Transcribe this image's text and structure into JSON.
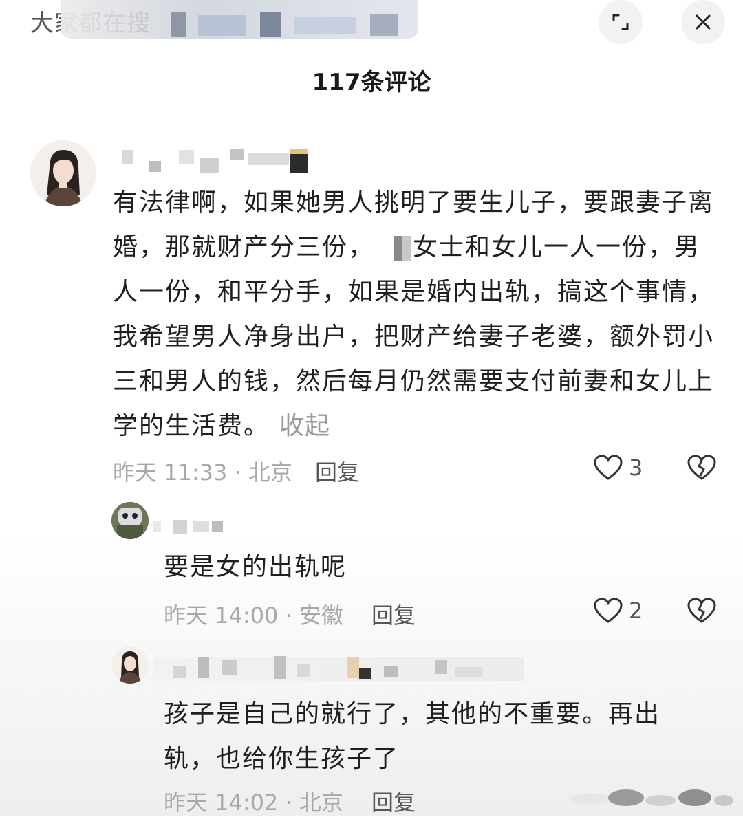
{
  "header": {
    "title_visible": "大家都在搜",
    "comment_count": "117条评论",
    "expand_icon": "expand-icon",
    "close_icon": "close-icon"
  },
  "comments": [
    {
      "avatar": "avatar-woman",
      "text_before_patch": "有法律啊，如果她男人挑明了要生儿子，要跟妻子离婚，那就财产分三份，",
      "text_after_patch": "女士和女儿一人一份，男人一份，和平分手，如果是婚内出轨，搞这个事情，我希望男人净身出户，把财产给妻子老婆，额外罚小三和男人的钱，然后每月仍然需要支付前妻和女儿上学的生活费。",
      "collapse_label": "收起",
      "meta": "昨天 11:33 · 北京",
      "reply_label": "回复",
      "likes": "3"
    },
    {
      "avatar": "avatar-cartoon",
      "text": "要是女的出轨呢",
      "meta": "昨天 14:00 · 安徽",
      "reply_label": "回复",
      "likes": "2"
    },
    {
      "avatar": "avatar-woman",
      "text": "孩子是自己的就行了，其他的不重要。再出轨，也给你生孩子了",
      "meta": "昨天 14:02 · 北京",
      "reply_label": "回复"
    }
  ],
  "colors": {
    "text": "#1f1f1f",
    "meta": "#a8a8a8",
    "icon": "#333333"
  }
}
